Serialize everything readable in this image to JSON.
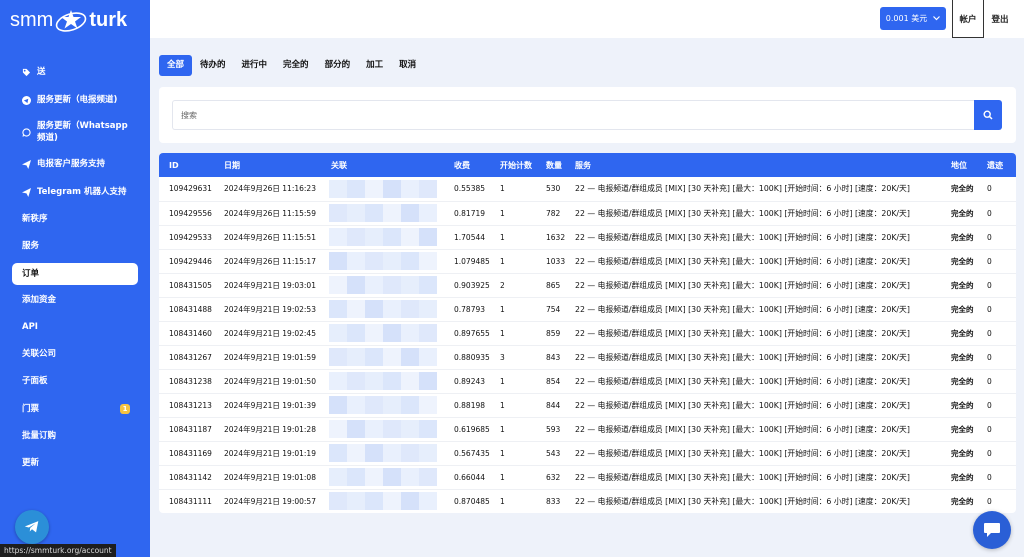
{
  "brand": {
    "logo_left": "smm",
    "logo_right": "turk"
  },
  "sidebar": {
    "items": [
      {
        "label": "送",
        "icon": "tag-icon"
      },
      {
        "label": "服务更新（电报频道)",
        "icon": "telegram-icon"
      },
      {
        "label": "服务更新（Whatsapp 频道)",
        "icon": "whatsapp-icon"
      },
      {
        "label": "电报客户服务支持",
        "icon": "send-icon"
      },
      {
        "label": "Telegram 机器人支持",
        "icon": "send-icon"
      },
      {
        "label": "新秩序",
        "icon": ""
      },
      {
        "label": "服务",
        "icon": ""
      },
      {
        "label": "订单",
        "icon": ""
      },
      {
        "label": "添加资金",
        "icon": ""
      },
      {
        "label": "API",
        "icon": ""
      },
      {
        "label": "关联公司",
        "icon": ""
      },
      {
        "label": "子面板",
        "icon": ""
      },
      {
        "label": "门票",
        "icon": "",
        "badge": "1"
      },
      {
        "label": "批量订购",
        "icon": ""
      },
      {
        "label": "更新",
        "icon": ""
      }
    ],
    "active_index": 7
  },
  "header": {
    "balance": "0.001 美元",
    "account": "帐户",
    "logout": "登出"
  },
  "tabs": [
    "全部",
    "待办的",
    "进行中",
    "完全的",
    "部分的",
    "加工",
    "取消"
  ],
  "active_tab": 0,
  "search": {
    "placeholder": "搜索"
  },
  "table": {
    "columns": [
      "ID",
      "日期",
      "关联",
      "收费",
      "开始计数",
      "数量",
      "服务",
      "地位",
      "遗迹"
    ],
    "rows": [
      {
        "id": "109429631",
        "date": "2024年9月26日 11:16:23",
        "charge": "0.55385",
        "start": "1",
        "qty": "530",
        "service": "22 — 电报频道/群组成员 [MIX] [30 天补充] [最大：100K] [开始时间：6 小时] [速度：20K/天]",
        "status": "完全的",
        "remains": "0"
      },
      {
        "id": "109429556",
        "date": "2024年9月26日 11:15:59",
        "charge": "0.81719",
        "start": "1",
        "qty": "782",
        "service": "22 — 电报频道/群组成员 [MIX] [30 天补充] [最大：100K] [开始时间：6 小时] [速度：20K/天]",
        "status": "完全的",
        "remains": "0"
      },
      {
        "id": "109429533",
        "date": "2024年9月26日 11:15:51",
        "charge": "1.70544",
        "start": "1",
        "qty": "1632",
        "service": "22 — 电报频道/群组成员 [MIX] [30 天补充] [最大：100K] [开始时间：6 小时] [速度：20K/天]",
        "status": "完全的",
        "remains": "0"
      },
      {
        "id": "109429446",
        "date": "2024年9月26日 11:15:17",
        "charge": "1.079485",
        "start": "1",
        "qty": "1033",
        "service": "22 — 电报频道/群组成员 [MIX] [30 天补充] [最大：100K] [开始时间：6 小时] [速度：20K/天]",
        "status": "完全的",
        "remains": "0"
      },
      {
        "id": "108431505",
        "date": "2024年9月21日 19:03:01",
        "charge": "0.903925",
        "start": "2",
        "qty": "865",
        "service": "22 — 电报频道/群组成员 [MIX] [30 天补充] [最大：100K] [开始时间：6 小时] [速度：20K/天]",
        "status": "完全的",
        "remains": "0"
      },
      {
        "id": "108431488",
        "date": "2024年9月21日 19:02:53",
        "charge": "0.78793",
        "start": "1",
        "qty": "754",
        "service": "22 — 电报频道/群组成员 [MIX] [30 天补充] [最大：100K] [开始时间：6 小时] [速度：20K/天]",
        "status": "完全的",
        "remains": "0"
      },
      {
        "id": "108431460",
        "date": "2024年9月21日 19:02:45",
        "charge": "0.897655",
        "start": "1",
        "qty": "859",
        "service": "22 — 电报频道/群组成员 [MIX] [30 天补充] [最大：100K] [开始时间：6 小时] [速度：20K/天]",
        "status": "完全的",
        "remains": "0"
      },
      {
        "id": "108431267",
        "date": "2024年9月21日 19:01:59",
        "charge": "0.880935",
        "start": "3",
        "qty": "843",
        "service": "22 — 电报频道/群组成员 [MIX] [30 天补充] [最大：100K] [开始时间：6 小时] [速度：20K/天]",
        "status": "完全的",
        "remains": "0"
      },
      {
        "id": "108431238",
        "date": "2024年9月21日 19:01:50",
        "charge": "0.89243",
        "start": "1",
        "qty": "854",
        "service": "22 — 电报频道/群组成员 [MIX] [30 天补充] [最大：100K] [开始时间：6 小时] [速度：20K/天]",
        "status": "完全的",
        "remains": "0"
      },
      {
        "id": "108431213",
        "date": "2024年9月21日 19:01:39",
        "charge": "0.88198",
        "start": "1",
        "qty": "844",
        "service": "22 — 电报频道/群组成员 [MIX] [30 天补充] [最大：100K] [开始时间：6 小时] [速度：20K/天]",
        "status": "完全的",
        "remains": "0"
      },
      {
        "id": "108431187",
        "date": "2024年9月21日 19:01:28",
        "charge": "0.619685",
        "start": "1",
        "qty": "593",
        "service": "22 — 电报频道/群组成员 [MIX] [30 天补充] [最大：100K] [开始时间：6 小时] [速度：20K/天]",
        "status": "完全的",
        "remains": "0"
      },
      {
        "id": "108431169",
        "date": "2024年9月21日 19:01:19",
        "charge": "0.567435",
        "start": "1",
        "qty": "543",
        "service": "22 — 电报频道/群组成员 [MIX] [30 天补充] [最大：100K] [开始时间：6 小时] [速度：20K/天]",
        "status": "完全的",
        "remains": "0"
      },
      {
        "id": "108431142",
        "date": "2024年9月21日 19:01:08",
        "charge": "0.66044",
        "start": "1",
        "qty": "632",
        "service": "22 — 电报频道/群组成员 [MIX] [30 天补充] [最大：100K] [开始时间：6 小时] [速度：20K/天]",
        "status": "完全的",
        "remains": "0"
      },
      {
        "id": "108431111",
        "date": "2024年9月21日 19:00:57",
        "charge": "0.870485",
        "start": "1",
        "qty": "833",
        "service": "22 — 电报频道/群组成员 [MIX] [30 天补充] [最大：100K] [开始时间：6 小时] [速度：20K/天]",
        "status": "完全的",
        "remains": "0"
      }
    ]
  },
  "status_bar": {
    "url": "https://smmturk.org/account"
  },
  "colors": {
    "primary": "#2f66f0",
    "page_bg": "#eef2fa",
    "telegram": "#2b8fd8",
    "badge": "#f6c342"
  }
}
